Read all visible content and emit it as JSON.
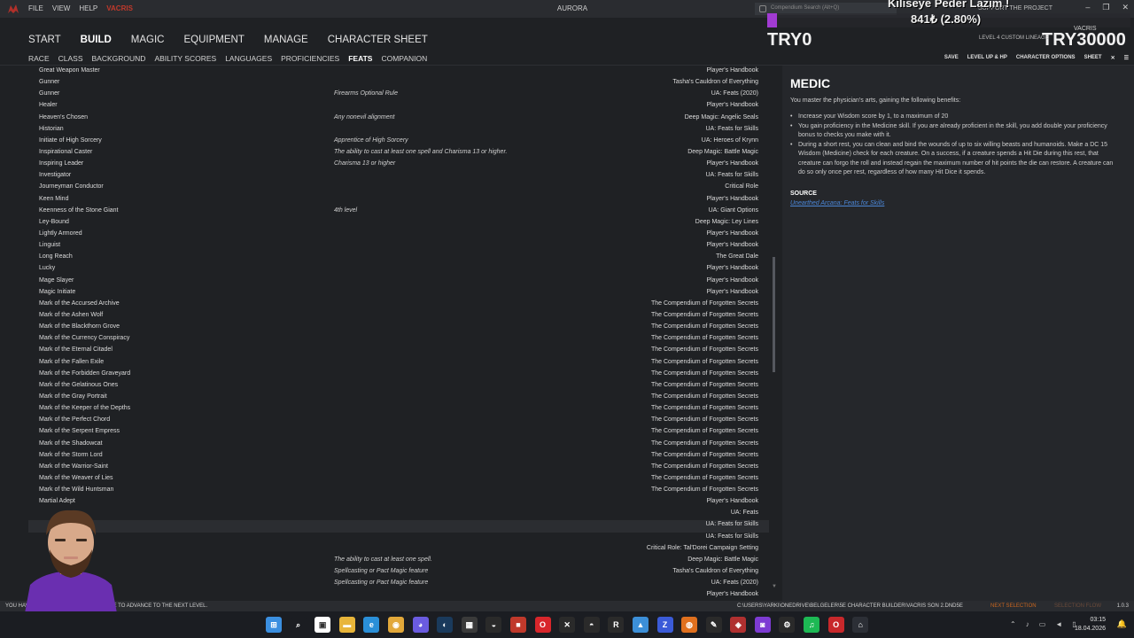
{
  "titlebar": {
    "menu": [
      "FILE",
      "VIEW",
      "HELP"
    ],
    "menu_accent": "VACRIS",
    "app_title": "AURORA",
    "search_placeholder": "Compendium Search (Alt+Q)",
    "project_link": "SUPPORT THE PROJECT"
  },
  "overlay": {
    "title": "Kiliseye Peder Lazım !",
    "progress_text": "841₺ (2.80%)",
    "progress_fraction": 0.028,
    "left_label": "TRY0",
    "right_label": "TRY30000"
  },
  "mainnav": {
    "items": [
      "START",
      "BUILD",
      "MAGIC",
      "EQUIPMENT",
      "MANAGE",
      "CHARACTER SHEET"
    ],
    "active": "BUILD"
  },
  "character": {
    "level_info": "LEVEL 4 CUSTOM LINEAGE",
    "name": "VACRIS"
  },
  "subnav": {
    "tabs": [
      "RACE",
      "CLASS",
      "BACKGROUND",
      "ABILITY SCORES",
      "LANGUAGES",
      "PROFICIENCIES",
      "FEATS",
      "COMPANION"
    ],
    "active": "FEATS",
    "actions": [
      "SAVE",
      "LEVEL UP & HP",
      "CHARACTER OPTIONS",
      "SHEET"
    ]
  },
  "feats": [
    {
      "name": "Great Weapon Master",
      "prereq": "",
      "source": "Player's Handbook"
    },
    {
      "name": "Gunner",
      "prereq": "",
      "source": "Tasha's Cauldron of Everything"
    },
    {
      "name": "Gunner",
      "prereq": "Firearms Optional Rule",
      "source": "UA: Feats (2020)"
    },
    {
      "name": "Healer",
      "prereq": "",
      "source": "Player's Handbook"
    },
    {
      "name": "Heaven's Chosen",
      "prereq": "Any nonevil alignment",
      "source": "Deep Magic: Angelic Seals"
    },
    {
      "name": "Historian",
      "prereq": "",
      "source": "UA: Feats for Skills"
    },
    {
      "name": "Initiate of High Sorcery",
      "prereq": "Apprentice of High Sorcery",
      "source": "UA: Heroes of Krynn"
    },
    {
      "name": "Inspirational Caster",
      "prereq": "The ability to cast at least one spell and Charisma 13 or higher.",
      "source": "Deep Magic: Battle Magic"
    },
    {
      "name": "Inspiring Leader",
      "prereq": "Charisma 13 or higher",
      "source": "Player's Handbook"
    },
    {
      "name": "Investigator",
      "prereq": "",
      "source": "UA: Feats for Skills"
    },
    {
      "name": "Journeyman Conductor",
      "prereq": "",
      "source": "Critical Role"
    },
    {
      "name": "Keen Mind",
      "prereq": "",
      "source": "Player's Handbook"
    },
    {
      "name": "Keenness of the Stone Giant",
      "prereq": "4th level",
      "source": "UA: Giant Options"
    },
    {
      "name": "Ley-Bound",
      "prereq": "",
      "source": "Deep Magic: Ley Lines"
    },
    {
      "name": "Lightly Armored",
      "prereq": "",
      "source": "Player's Handbook"
    },
    {
      "name": "Linguist",
      "prereq": "",
      "source": "Player's Handbook"
    },
    {
      "name": "Long Reach",
      "prereq": "",
      "source": "The Great Dale"
    },
    {
      "name": "Lucky",
      "prereq": "",
      "source": "Player's Handbook"
    },
    {
      "name": "Mage Slayer",
      "prereq": "",
      "source": "Player's Handbook"
    },
    {
      "name": "Magic Initiate",
      "prereq": "",
      "source": "Player's Handbook"
    },
    {
      "name": "Mark of the Accursed Archive",
      "prereq": "",
      "source": "The Compendium of Forgotten Secrets"
    },
    {
      "name": "Mark of the Ashen Wolf",
      "prereq": "",
      "source": "The Compendium of Forgotten Secrets"
    },
    {
      "name": "Mark of the Blackthorn Grove",
      "prereq": "",
      "source": "The Compendium of Forgotten Secrets"
    },
    {
      "name": "Mark of the Currency Conspiracy",
      "prereq": "",
      "source": "The Compendium of Forgotten Secrets"
    },
    {
      "name": "Mark of the Eternal Citadel",
      "prereq": "",
      "source": "The Compendium of Forgotten Secrets"
    },
    {
      "name": "Mark of the Fallen Exile",
      "prereq": "",
      "source": "The Compendium of Forgotten Secrets"
    },
    {
      "name": "Mark of the Forbidden Graveyard",
      "prereq": "",
      "source": "The Compendium of Forgotten Secrets"
    },
    {
      "name": "Mark of the Gelatinous Ones",
      "prereq": "",
      "source": "The Compendium of Forgotten Secrets"
    },
    {
      "name": "Mark of the Gray Portrait",
      "prereq": "",
      "source": "The Compendium of Forgotten Secrets"
    },
    {
      "name": "Mark of the Keeper of the Depths",
      "prereq": "",
      "source": "The Compendium of Forgotten Secrets"
    },
    {
      "name": "Mark of the Perfect Chord",
      "prereq": "",
      "source": "The Compendium of Forgotten Secrets"
    },
    {
      "name": "Mark of the Serpent Empress",
      "prereq": "",
      "source": "The Compendium of Forgotten Secrets"
    },
    {
      "name": "Mark of the Shadowcat",
      "prereq": "",
      "source": "The Compendium of Forgotten Secrets"
    },
    {
      "name": "Mark of the Storm Lord",
      "prereq": "",
      "source": "The Compendium of Forgotten Secrets"
    },
    {
      "name": "Mark of the Warrior-Saint",
      "prereq": "",
      "source": "The Compendium of Forgotten Secrets"
    },
    {
      "name": "Mark of the Weaver of Lies",
      "prereq": "",
      "source": "The Compendium of Forgotten Secrets"
    },
    {
      "name": "Mark of the Wild Huntsman",
      "prereq": "",
      "source": "The Compendium of Forgotten Secrets"
    },
    {
      "name": "Martial Adept",
      "prereq": "",
      "source": "Player's Handbook"
    },
    {
      "name": "",
      "prereq": "",
      "source": "UA: Feats"
    },
    {
      "name": "",
      "prereq": "",
      "source": "UA: Feats for Skills"
    },
    {
      "name": "",
      "prereq": "",
      "source": "UA: Feats for Skills"
    },
    {
      "name": "",
      "prereq": "",
      "source": "Critical Role: Tal'Dorei Campaign Setting"
    },
    {
      "name": "",
      "prereq": "The ability to cast at least one spell.",
      "source": "Deep Magic: Battle Magic"
    },
    {
      "name": "",
      "prereq": "Spellcasting or Pact Magic feature",
      "source": "Tasha's Cauldron of Everything"
    },
    {
      "name": "",
      "prereq": "Spellcasting or Pact Magic feature",
      "source": "UA: Feats (2020)"
    },
    {
      "name": "",
      "prereq": "",
      "source": "Player's Handbook"
    }
  ],
  "selected_index": 39,
  "detail": {
    "title": "MEDIC",
    "intro": "You master the physician's arts, gaining the following benefits:",
    "bullets": [
      "Increase your Wisdom score by 1, to a maximum of 20",
      "You gain proficiency in the Medicine skill. If you are already proficient in the skill, you add double your proficiency bonus to checks you make with it.",
      "During a short rest, you can clean and bind the wounds of up to six willing beasts and humanoids. Make a DC 15 Wisdom (Medicine) check for each creature. On a success, if a creature spends a Hit Die during this rest, that creature can forgo the roll and instead regain the maximum number of hit points the die can restore. A creature can do so only once per rest, regardless of how many Hit Dice it spends."
    ],
    "source_heading": "SOURCE",
    "source_link": "Unearthed Arcana: Feats for Skills"
  },
  "statusbar": {
    "message": "YOU HAVE EARNED ENOUGH EXPERIENCE TO ADVANCE TO THE NEXT LEVEL.",
    "path": "C:\\USERS\\YARKI\\ONEDRIVE\\BELGELER\\5E CHARACTER BUILDER\\VACRIS SON 2.DND5E",
    "next_selection": "NEXT SELECTION",
    "selection_flow": "SELECTION FLOW",
    "version": "1.0.3"
  },
  "taskbar": {
    "clock_time": "03:15",
    "clock_date": "18.04.2026",
    "icons": [
      {
        "name": "windows-start-icon",
        "color": "#3b8fe0",
        "glyph": "⊞"
      },
      {
        "name": "search-icon",
        "color": "#1b1d22",
        "glyph": "⌕"
      },
      {
        "name": "task-view-icon",
        "color": "#ffffff",
        "glyph": "▣"
      },
      {
        "name": "file-explorer-icon",
        "color": "#e8b53a",
        "glyph": "▬"
      },
      {
        "name": "edge-icon",
        "color": "#2a8fd8",
        "glyph": "e"
      },
      {
        "name": "chrome-icon",
        "color": "#e2a83a",
        "glyph": "◉"
      },
      {
        "name": "discord-icon",
        "color": "#6a5be0",
        "glyph": "◕"
      },
      {
        "name": "steam-icon",
        "color": "#1a3a5c",
        "glyph": "◐"
      },
      {
        "name": "calculator-icon",
        "color": "#3a3a3a",
        "glyph": "▦"
      },
      {
        "name": "github-icon",
        "color": "#2a2a2a",
        "glyph": "◒"
      },
      {
        "name": "game-icon",
        "color": "#c0392b",
        "glyph": "■"
      },
      {
        "name": "opera-icon",
        "color": "#d8262b",
        "glyph": "O"
      },
      {
        "name": "capcut-icon",
        "color": "#2a2a2a",
        "glyph": "✕"
      },
      {
        "name": "obs-icon",
        "color": "#2a2a2a",
        "glyph": "◓"
      },
      {
        "name": "r-app-icon",
        "color": "#2a2a2a",
        "glyph": "R"
      },
      {
        "name": "photos-icon",
        "color": "#3c8fd8",
        "glyph": "▲"
      },
      {
        "name": "zoom-icon",
        "color": "#3b5bd8",
        "glyph": "Z"
      },
      {
        "name": "firefox-icon",
        "color": "#e0701e",
        "glyph": "◍"
      },
      {
        "name": "pen-icon",
        "color": "#2a2a2a",
        "glyph": "✎"
      },
      {
        "name": "shield-icon",
        "color": "#b03030",
        "glyph": "◈"
      },
      {
        "name": "purple-app-icon",
        "color": "#7d3bd3",
        "glyph": "◙"
      },
      {
        "name": "gear-icon",
        "color": "#2a2a2a",
        "glyph": "⚙"
      },
      {
        "name": "spotify-icon",
        "color": "#1db954",
        "glyph": "♫"
      },
      {
        "name": "opera-gx-icon",
        "color": "#c8282b",
        "glyph": "O"
      },
      {
        "name": "aurora-icon",
        "color": "#2c2f36",
        "glyph": "⌂"
      }
    ]
  }
}
